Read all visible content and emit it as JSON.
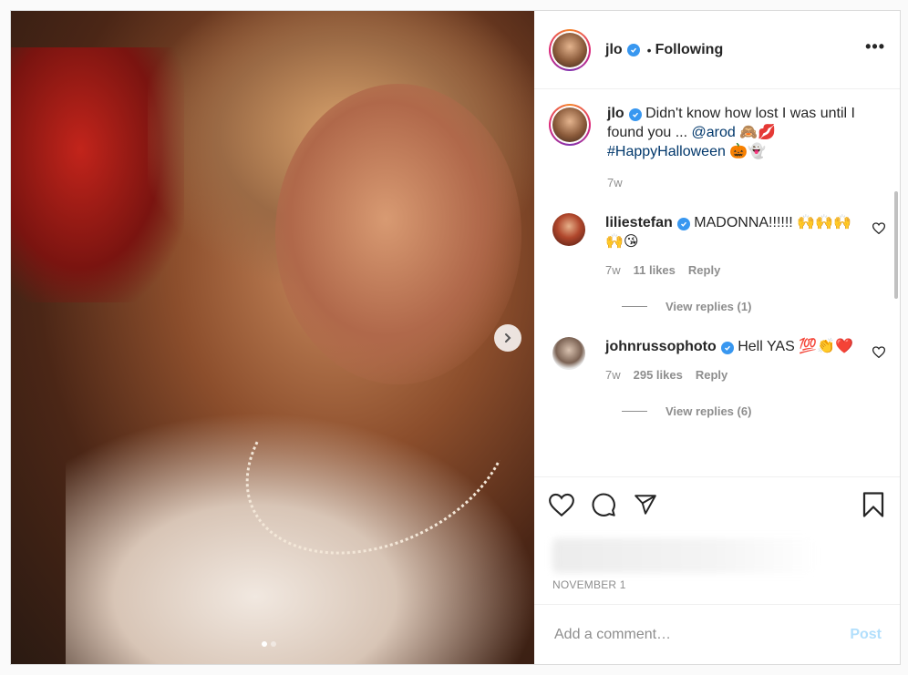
{
  "post": {
    "username": "jlo",
    "follow_status": "Following",
    "more_label": "•••",
    "caption": {
      "username": "jlo",
      "text": "Didn't know how lost I was until I found you ... ",
      "mention": "@arod",
      "mention_emojis": "🙈💋",
      "hashtag": "#HappyHalloween",
      "hashtag_emojis": "🎃👻",
      "time": "7w"
    },
    "comments": [
      {
        "username": "liliestefan",
        "text": "MADONNA!!!!!! 🙌🙌🙌🙌😘",
        "time": "7w",
        "likes": "11 likes",
        "reply_label": "Reply",
        "view_replies": "View replies (1)"
      },
      {
        "username": "johnrussophoto",
        "text": "Hell YAS 💯👏❤️",
        "time": "7w",
        "likes": "295 likes",
        "reply_label": "Reply",
        "view_replies": "View replies (6)"
      }
    ],
    "date": "NOVEMBER 1",
    "add_comment_placeholder": "Add a comment…",
    "post_label": "Post",
    "carousel": {
      "total": 2,
      "active": 1
    }
  },
  "colors": {
    "link": "#00376b",
    "verified": "#3897f0",
    "muted": "#8e8e8e",
    "post_disabled": "#b2dffc"
  }
}
